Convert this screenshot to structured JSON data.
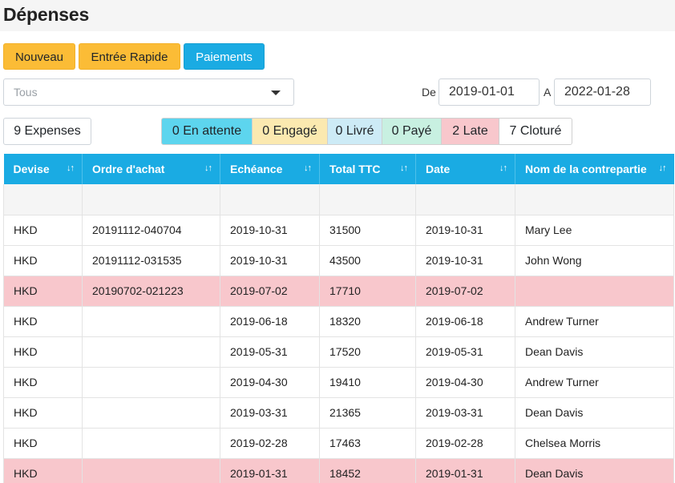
{
  "page": {
    "title": "Dépenses"
  },
  "toolbar": {
    "new_label": "Nouveau",
    "quick_entry_label": "Entrée Rapide",
    "payments_label": "Paiements"
  },
  "filter": {
    "select_value": "Tous",
    "date_from_label": "De",
    "date_from": "2019-01-01",
    "date_to_label": "A",
    "date_to": "2022-01-28"
  },
  "summary": {
    "count_label": "9 Expenses",
    "statuses": [
      {
        "label": "0 En attente",
        "color": "#5dd5ee"
      },
      {
        "label": "0 Engagé",
        "color": "#fbe9b0"
      },
      {
        "label": "0 Livré",
        "color": "#cdebf6"
      },
      {
        "label": "0 Payé",
        "color": "#c8f0e1"
      },
      {
        "label": "2 Late",
        "color": "#f8c7cc"
      },
      {
        "label": "7 Cloturé",
        "color": "#ffffff"
      }
    ]
  },
  "colors": {
    "accent": "#1aabe3",
    "warning": "#fbbc36",
    "late_row": "#f8c7cc"
  },
  "table": {
    "columns": [
      "Devise",
      "Ordre d'achat",
      "Echéance",
      "Total TTC",
      "Date",
      "Nom de la contrepartie"
    ],
    "sort_icon": "sort-arrows-icon",
    "rows": [
      {
        "devise": "HKD",
        "ordre": "20191112-040704",
        "echeance": "2019-10-31",
        "total": "31500",
        "date": "2019-10-31",
        "contrepartie": "Mary Lee",
        "late": false
      },
      {
        "devise": "HKD",
        "ordre": "20191112-031535",
        "echeance": "2019-10-31",
        "total": "43500",
        "date": "2019-10-31",
        "contrepartie": "John Wong",
        "late": false
      },
      {
        "devise": "HKD",
        "ordre": "20190702-021223",
        "echeance": "2019-07-02",
        "total": "17710",
        "date": "2019-07-02",
        "contrepartie": "",
        "late": true
      },
      {
        "devise": "HKD",
        "ordre": "",
        "echeance": "2019-06-18",
        "total": "18320",
        "date": "2019-06-18",
        "contrepartie": "Andrew Turner",
        "late": false
      },
      {
        "devise": "HKD",
        "ordre": "",
        "echeance": "2019-05-31",
        "total": "17520",
        "date": "2019-05-31",
        "contrepartie": "Dean Davis",
        "late": false
      },
      {
        "devise": "HKD",
        "ordre": "",
        "echeance": "2019-04-30",
        "total": "19410",
        "date": "2019-04-30",
        "contrepartie": "Andrew Turner",
        "late": false
      },
      {
        "devise": "HKD",
        "ordre": "",
        "echeance": "2019-03-31",
        "total": "21365",
        "date": "2019-03-31",
        "contrepartie": "Dean Davis",
        "late": false
      },
      {
        "devise": "HKD",
        "ordre": "",
        "echeance": "2019-02-28",
        "total": "17463",
        "date": "2019-02-28",
        "contrepartie": "Chelsea Morris",
        "late": false
      },
      {
        "devise": "HKD",
        "ordre": "",
        "echeance": "2019-01-31",
        "total": "18452",
        "date": "2019-01-31",
        "contrepartie": "Dean Davis",
        "late": true
      }
    ]
  }
}
